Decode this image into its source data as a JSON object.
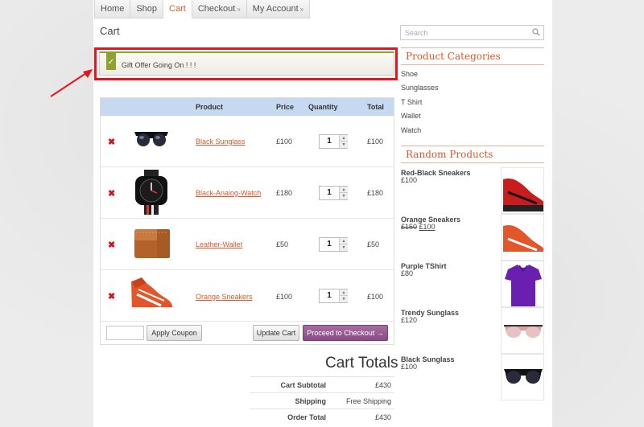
{
  "nav": {
    "items": [
      {
        "label": "Home"
      },
      {
        "label": "Shop"
      },
      {
        "label": "Cart",
        "active": true
      },
      {
        "label": "Checkout",
        "has_submenu": true
      },
      {
        "label": "My Account",
        "has_submenu": true
      }
    ],
    "submenu_glyph": "»"
  },
  "page_title": "Cart",
  "notice": {
    "icon": "check-icon",
    "text": "Gift Offer Going On ! ! !"
  },
  "cart_table": {
    "headers": {
      "product": "Product",
      "price": "Price",
      "quantity": "Quantity",
      "total": "Total"
    },
    "rows": [
      {
        "name": "Black Sunglass",
        "price": "£100",
        "qty": "1",
        "total": "£100",
        "image": "sunglass-image"
      },
      {
        "name": "Black-Analog-Watch",
        "price": "£180",
        "qty": "1",
        "total": "£180",
        "image": "watch-image"
      },
      {
        "name": "Leather-Wallet",
        "price": "£50",
        "qty": "1",
        "total": "£50",
        "image": "wallet-image"
      },
      {
        "name": "Orange Sneakers",
        "price": "£100",
        "qty": "1",
        "total": "£100",
        "image": "sneaker-image"
      }
    ],
    "remove_glyph": "✖",
    "apply_coupon_label": "Apply Coupon",
    "update_cart_label": "Update Cart",
    "checkout_label": "Proceed to Checkout →"
  },
  "totals": {
    "title": "Cart Totals",
    "rows": [
      {
        "label": "Cart Subtotal",
        "value": "£430"
      },
      {
        "label": "Shipping",
        "value": "Free Shipping"
      },
      {
        "label": "Order Total",
        "value": "£430"
      }
    ]
  },
  "sidebar": {
    "search_placeholder": "Search",
    "categories_title": "Product Categories",
    "categories": [
      "Shoe",
      "Sunglasses",
      "T Shirt",
      "Wallet",
      "Watch"
    ],
    "random_title": "Random Products",
    "random_products": [
      {
        "name": "Red-Black Sneakers",
        "price": "£100"
      },
      {
        "name": "Orange Sneakers",
        "old_price": "£150",
        "price": "£100"
      },
      {
        "name": "Purple TShirt",
        "price": "£80"
      },
      {
        "name": "Trendy Sunglass",
        "price": "£120"
      },
      {
        "name": "Black Sunglass",
        "price": "£100"
      }
    ]
  },
  "colors": {
    "accent": "#d85a2a",
    "highlight": "#e8141b",
    "table_header": "#c6d9f1",
    "checkout_button": "#8a4b86",
    "notice_check": "#8fa12e"
  }
}
